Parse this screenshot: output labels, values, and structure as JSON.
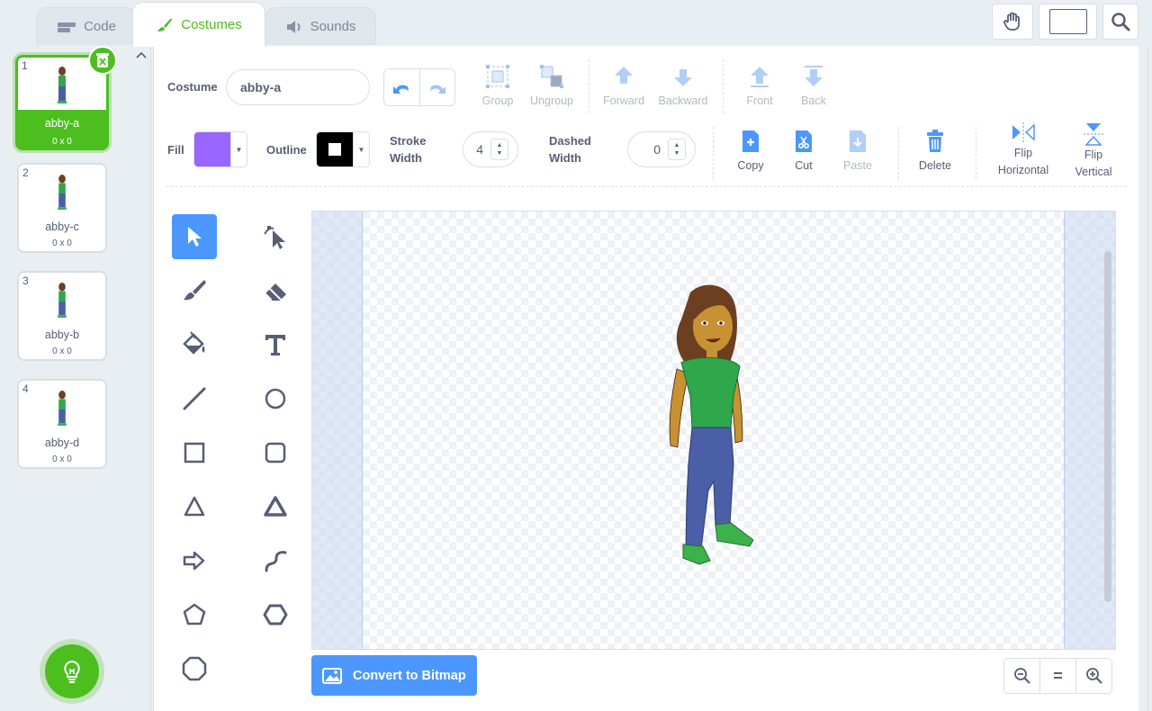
{
  "tabs": [
    {
      "label": "Code",
      "icon": "code-icon"
    },
    {
      "label": "Costumes",
      "icon": "brush-icon"
    },
    {
      "label": "Sounds",
      "icon": "speaker-icon"
    }
  ],
  "toolbar_right": {
    "icons": [
      "hand-pan-icon",
      "stage-size-icon",
      "search-icon"
    ]
  },
  "costumes": [
    {
      "num": "1",
      "name": "abby-a",
      "size": "0 x 0",
      "selected": true
    },
    {
      "num": "2",
      "name": "abby-c",
      "size": "0 x 0"
    },
    {
      "num": "3",
      "name": "abby-b",
      "size": "0 x 0"
    },
    {
      "num": "4",
      "name": "abby-d",
      "size": "0 x 0"
    }
  ],
  "editor": {
    "costume_label": "Costume",
    "costume_name": "abby-a",
    "arrange": {
      "group": "Group",
      "ungroup": "Ungroup",
      "forward": "Forward",
      "backward": "Backward",
      "front": "Front",
      "back": "Back"
    },
    "fill_label": "Fill",
    "fill_color": "#9966ff",
    "outline_label": "Outline",
    "outline_color": "#000000",
    "stroke_width_label_1": "Stroke",
    "stroke_width_label_2": "Width",
    "stroke_width": "4",
    "dashed_width_label_1": "Dashed",
    "dashed_width_label_2": "Width",
    "dashed_width": "0",
    "actions": {
      "copy": "Copy",
      "cut": "Cut",
      "paste": "Paste",
      "delete": "Delete",
      "flip_h_1": "Flip",
      "flip_h_2": "Horizontal",
      "flip_v_1": "Flip",
      "flip_v_2": "Vertical"
    },
    "convert_label": "Convert to Bitmap",
    "zoom_reset": "="
  },
  "tools": [
    "select-arrow-icon",
    "reshape-icon",
    "brush-icon",
    "eraser-icon",
    "fill-bucket-icon",
    "text-icon",
    "line-icon",
    "circle-icon",
    "rectangle-icon",
    "rounded-rectangle-icon",
    "triangle-icon",
    "filled-triangle-icon",
    "arrow-shape-icon",
    "curve-icon",
    "pentagon-icon",
    "hexagon-icon",
    "octagon-icon"
  ],
  "colors": {
    "accent": "#4c97ff",
    "green": "#4cbf1f",
    "text": "#575e75"
  }
}
